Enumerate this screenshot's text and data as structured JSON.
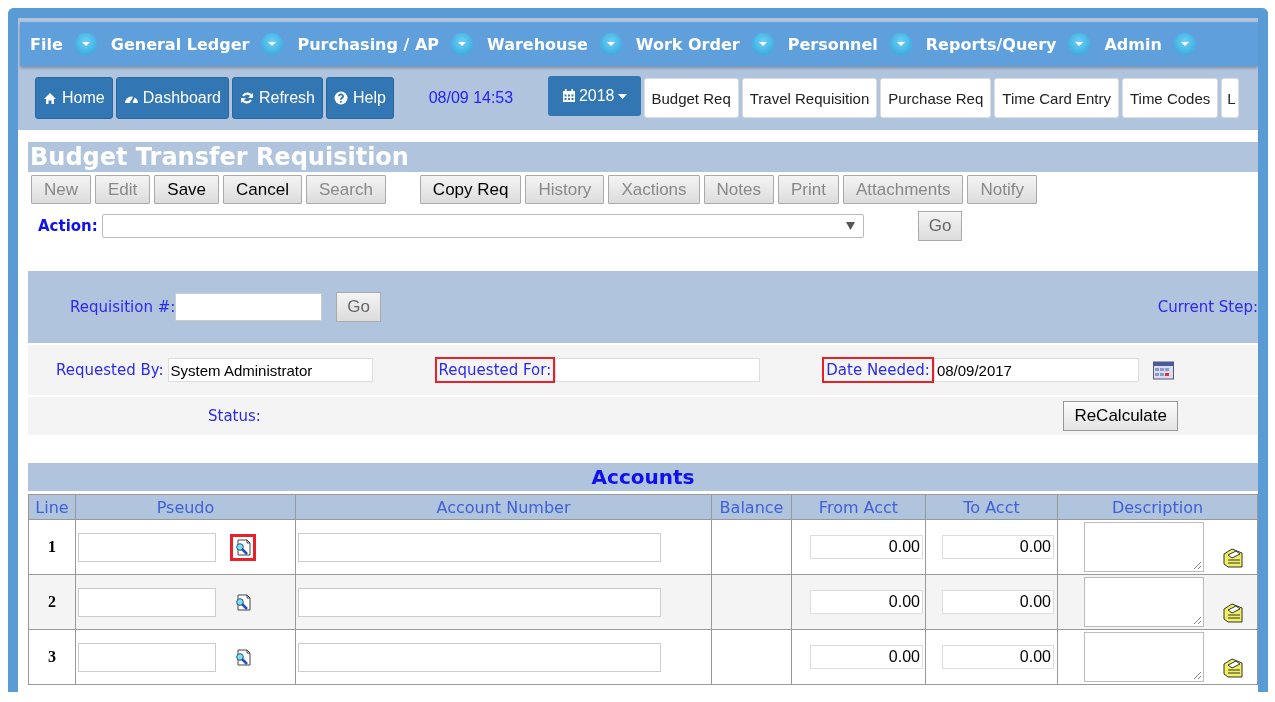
{
  "menu": [
    {
      "label": "File"
    },
    {
      "label": "General Ledger"
    },
    {
      "label": "Purchasing / AP"
    },
    {
      "label": "Warehouse"
    },
    {
      "label": "Work Order"
    },
    {
      "label": "Personnel"
    },
    {
      "label": "Reports/Query"
    },
    {
      "label": "Admin"
    }
  ],
  "toolbar": {
    "buttons": [
      {
        "label": "Home"
      },
      {
        "label": "Dashboard"
      },
      {
        "label": "Refresh"
      },
      {
        "label": "Help"
      }
    ],
    "clock": "08/09 14:53",
    "year": "2018",
    "shortcuts": [
      "Budget Req",
      "Travel Requisition",
      "Purchase Req",
      "Time Card Entry",
      "Time Codes",
      "L"
    ]
  },
  "page_title": "Budget Transfer Requisition",
  "actions": [
    {
      "label": "New",
      "disabled": true
    },
    {
      "label": "Edit",
      "disabled": true
    },
    {
      "label": "Save",
      "disabled": false
    },
    {
      "label": "Cancel",
      "disabled": false
    },
    {
      "label": "Search",
      "disabled": true
    },
    {
      "label": "Copy Req",
      "disabled": false
    },
    {
      "label": "History",
      "disabled": true
    },
    {
      "label": "Xactions",
      "disabled": true
    },
    {
      "label": "Notes",
      "disabled": true
    },
    {
      "label": "Print",
      "disabled": true
    },
    {
      "label": "Attachments",
      "disabled": true
    },
    {
      "label": "Notify",
      "disabled": true
    }
  ],
  "action_select": {
    "label": "Action:",
    "go": "Go"
  },
  "requisition": {
    "label": "Requisition #:",
    "go": "Go",
    "current_step": "Current Step:"
  },
  "fields": [
    {
      "label": "Requested By:",
      "value": "System Administrator",
      "highlighted": false
    },
    {
      "label": "Requested For:",
      "highlighted": true
    },
    {
      "label": "Date Needed:",
      "value": "08/09/2017",
      "highlighted": true
    }
  ],
  "status_label": "Status:",
  "recalculate": "ReCalculate",
  "accounts": {
    "title": "Accounts",
    "columns": [
      "Line",
      "Pseudo",
      "Account Number",
      "Balance",
      "From Acct",
      "To Acct",
      "Description"
    ],
    "rows": [
      {
        "line": "1",
        "from": "0.00",
        "to": "0.00",
        "highlighted": true
      },
      {
        "line": "2",
        "from": "0.00",
        "to": "0.00",
        "highlighted": false
      },
      {
        "line": "3",
        "from": "0.00",
        "to": "0.00",
        "highlighted": false
      }
    ]
  }
}
